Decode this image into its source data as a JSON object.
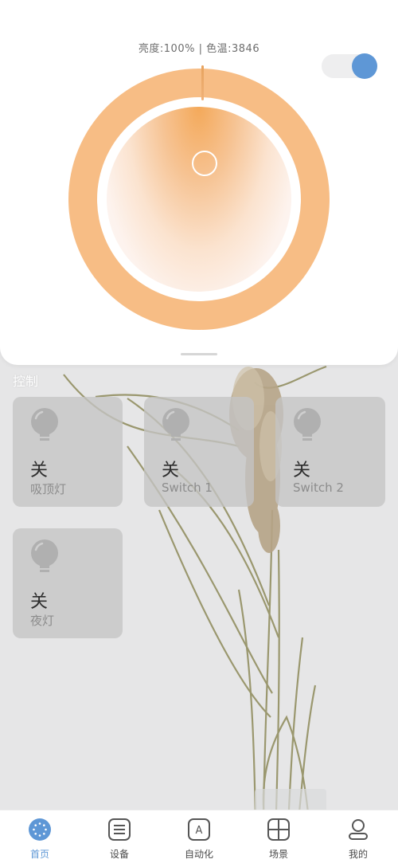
{
  "panel": {
    "brightness_label": "亮度:",
    "brightness_value": "100%",
    "separator": " | ",
    "color_temp_label": "色温:",
    "color_temp_value": "3846",
    "power_on": true,
    "brightness_level": 1.0
  },
  "colors": {
    "accent": "#5e97d6",
    "ring": "#f7bd85",
    "card_bg": "#c4c4c4"
  },
  "controls": {
    "title": "控制",
    "devices": [
      {
        "state": "关",
        "name": "吸顶灯",
        "icon": "bulb-icon"
      },
      {
        "state": "关",
        "name": "Switch 1",
        "icon": "bulb-icon"
      },
      {
        "state": "关",
        "name": "Switch 2",
        "icon": "bulb-icon"
      },
      {
        "state": "关",
        "name": "夜灯",
        "icon": "bulb-icon"
      }
    ]
  },
  "tabs": [
    {
      "label": "首页",
      "icon": "home-dots-icon",
      "active": true
    },
    {
      "label": "设备",
      "icon": "device-list-icon",
      "active": false
    },
    {
      "label": "自动化",
      "icon": "automation-a-icon",
      "active": false
    },
    {
      "label": "场景",
      "icon": "scene-grid-icon",
      "active": false
    },
    {
      "label": "我的",
      "icon": "profile-icon",
      "active": false
    }
  ]
}
